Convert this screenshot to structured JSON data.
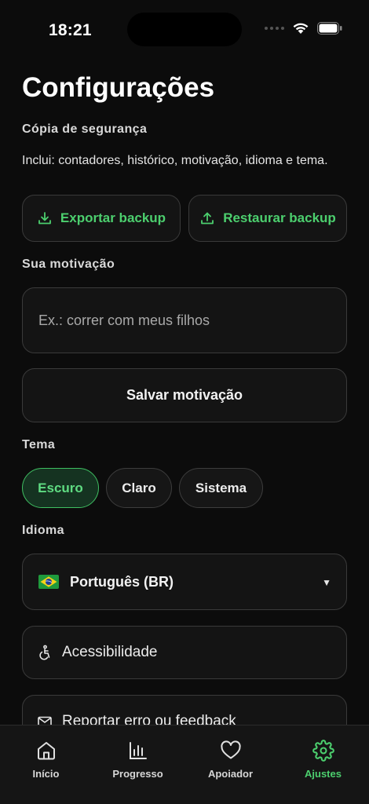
{
  "status_bar": {
    "time": "18:21"
  },
  "page": {
    "title": "Configurações"
  },
  "backup": {
    "section_label": "Cópia de segurança",
    "description": "Inclui: contadores, histórico, motivação, idioma e tema.",
    "export_label": "Exportar backup",
    "restore_label": "Restaurar backup"
  },
  "motivation": {
    "section_label": "Sua motivação",
    "value": "",
    "placeholder": "Ex.: correr com meus filhos",
    "save_label": "Salvar motivação"
  },
  "theme": {
    "section_label": "Tema",
    "options": [
      {
        "label": "Escuro",
        "selected": true
      },
      {
        "label": "Claro",
        "selected": false
      },
      {
        "label": "Sistema",
        "selected": false
      }
    ]
  },
  "language": {
    "section_label": "Idioma",
    "selected": "Português (BR)",
    "flag_icon": "brazil-flag-icon",
    "caret": "▼"
  },
  "links": {
    "accessibility_label": "Acessibilidade",
    "feedback_label": "Reportar erro ou feedback"
  },
  "tab_bar": {
    "tabs": [
      {
        "label": "Início",
        "icon": "home-icon"
      },
      {
        "label": "Progresso",
        "icon": "bar-chart-icon"
      },
      {
        "label": "Apoiador",
        "icon": "heart-icon"
      },
      {
        "label": "Ajustes",
        "icon": "gear-icon",
        "active": true
      }
    ]
  },
  "colors": {
    "background": "#0c0c0c",
    "accent": "#4ccf6e",
    "card_border": "#3a3a3a"
  }
}
